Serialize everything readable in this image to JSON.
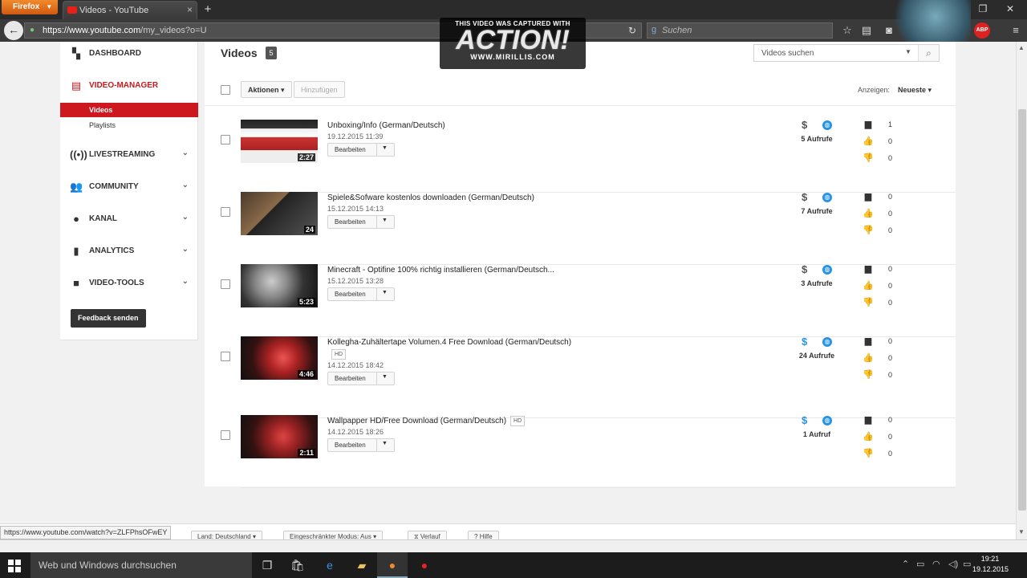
{
  "browser": {
    "app_button": "Firefox",
    "tab_title": "Videos - YouTube",
    "url_host": "https://www.youtube.com",
    "url_path": "/my_videos?o=U",
    "search_placeholder": "Suchen",
    "status_url": "https://www.youtube.com/watch?v=ZLFPhsOFwEY"
  },
  "watermark": {
    "line1": "THIS VIDEO WAS CAPTURED WITH",
    "line2": "ACTION!",
    "line3": "WWW.MIRILLIS.COM"
  },
  "sidebar": {
    "dashboard": "DASHBOARD",
    "video_manager": "VIDEO-MANAGER",
    "videos": "Videos",
    "playlists": "Playlists",
    "livestreaming": "LIVESTREAMING",
    "community": "COMMUNITY",
    "kanal": "KANAL",
    "analytics": "ANALYTICS",
    "video_tools": "VIDEO-TOOLS",
    "feedback": "Feedback senden"
  },
  "main": {
    "title": "Videos",
    "count": "5",
    "search_placeholder": "Videos suchen",
    "actions_label": "Aktionen",
    "add_label": "Hinzufügen",
    "sort_label": "Anzeigen:",
    "sort_value": "Neueste",
    "edit_label": "Bearbeiten"
  },
  "videos": [
    {
      "title": "Unboxing/Info (German/Deutsch)",
      "hd": "",
      "date": "19.12.2015 11:39",
      "duration": "2:27",
      "views": "5 Aufrufe",
      "comments": "1",
      "likes": "0",
      "dislikes": "0",
      "monetized": false
    },
    {
      "title": "Spiele&Sofware kostenlos downloaden (German/Deutsch)",
      "hd": "",
      "date": "15.12.2015 14:13",
      "duration": "24",
      "views": "7 Aufrufe",
      "comments": "0",
      "likes": "0",
      "dislikes": "0",
      "monetized": false
    },
    {
      "title": "Minecraft - Optifine 100% richtig installieren (German/Deutsch...",
      "hd": "",
      "date": "15.12.2015 13:28",
      "duration": "5:23",
      "views": "3 Aufrufe",
      "comments": "0",
      "likes": "0",
      "dislikes": "0",
      "monetized": false
    },
    {
      "title": "Kollegha-Zuhältertape Volumen.4 Free Download (German/Deutsch)",
      "hd": "HD",
      "date": "14.12.2015 18:42",
      "duration": "4:46",
      "views": "24 Aufrufe",
      "comments": "0",
      "likes": "0",
      "dislikes": "0",
      "monetized": true
    },
    {
      "title": "Wallpapper HD/Free Download (German/Deutsch)",
      "hd": "HD",
      "date": "14.12.2015 18:26",
      "duration": "2:11",
      "views": "1 Aufruf",
      "comments": "0",
      "likes": "0",
      "dislikes": "0",
      "monetized": true
    }
  ],
  "footer": {
    "country": "Land: Deutschland",
    "restricted": "Eingeschränkter Modus: Aus",
    "history": "Verlauf",
    "help": "Hilfe"
  },
  "taskbar": {
    "search_placeholder": "Web und Windows durchsuchen",
    "time": "19:21",
    "date": "19.12.2015"
  },
  "colors": {
    "accent": "#cc181e",
    "link_blue": "#2793e6"
  }
}
